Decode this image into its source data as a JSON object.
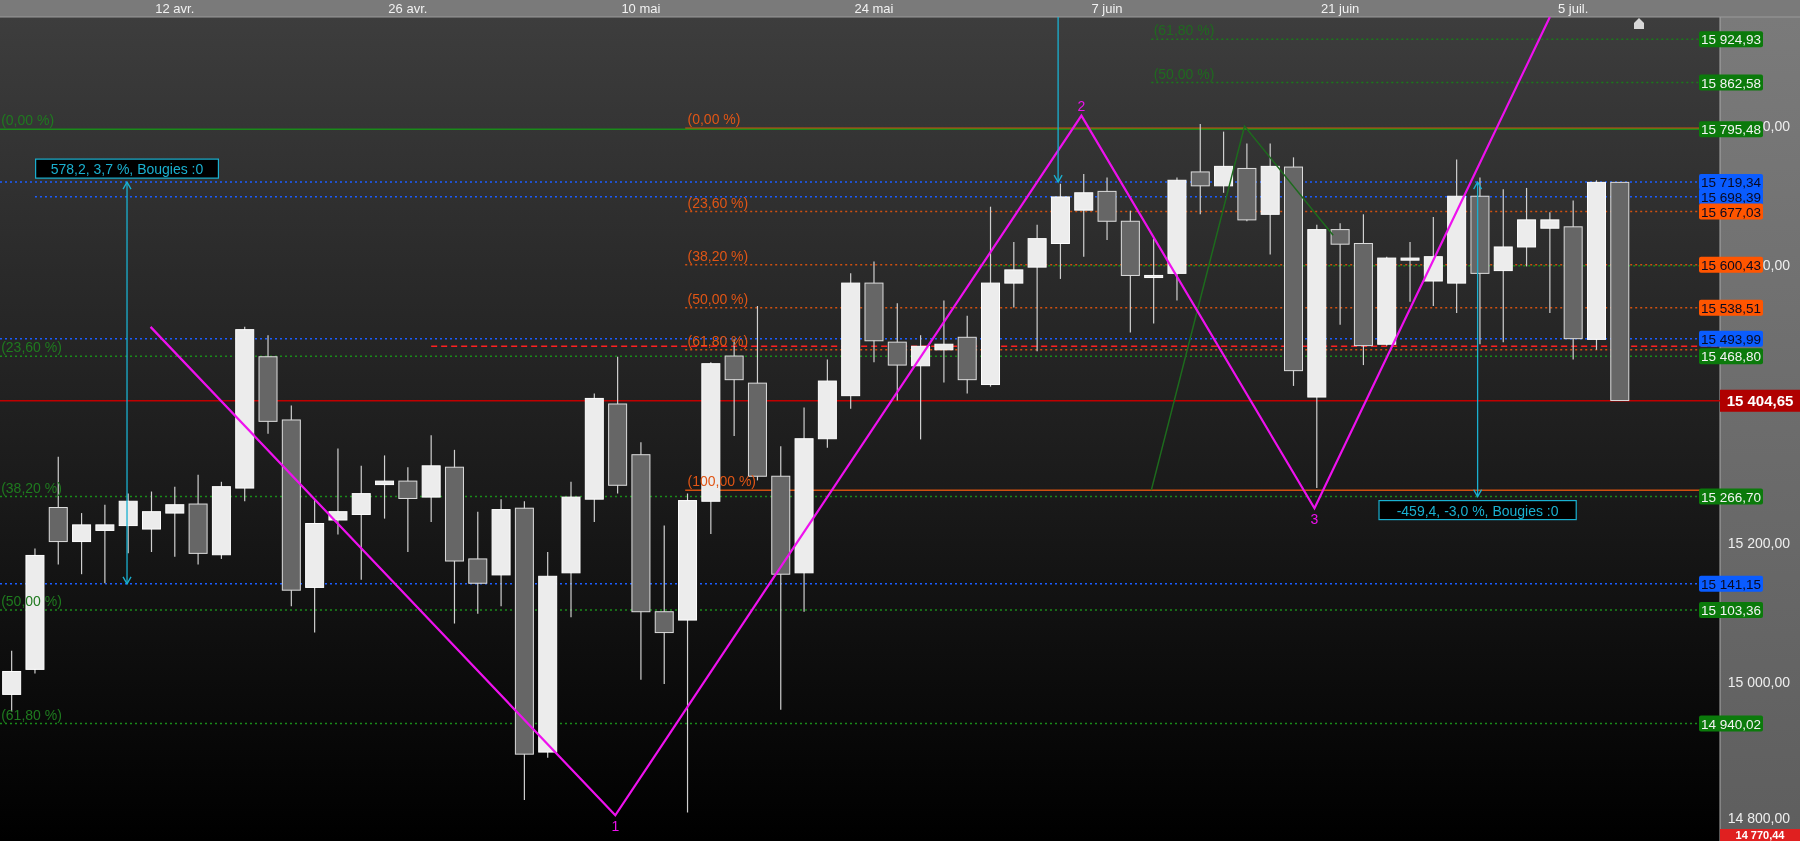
{
  "date_axis": [
    "12 avr.",
    "26 avr.",
    "10 mai",
    "24 mai",
    "7 juin",
    "21 juin",
    "5 juil."
  ],
  "price_axis": [
    "0,00",
    "0,00",
    "15 200,00",
    "15 000,00",
    "14 800,00"
  ],
  "fibonacci_labels": [
    "(0,00 %)",
    "(23,60 %)",
    "(38,20 %)",
    "(50,00 %)",
    "(61,80 %)",
    "(61,80 %)",
    "(50,00 %)",
    "(0,00 %)",
    "(23,60 %)",
    "(38,20 %)",
    "(50,00 %)",
    "(61,80 %)",
    "(100,00 %)"
  ],
  "wave_labels": [
    "1",
    "2",
    "3"
  ],
  "measure_labels": [
    "578,2, 3,7 %, Bougies :0",
    "-459,4, -3,0 %, Bougies :0"
  ],
  "price_tags": [
    {
      "text": "15 924,93",
      "color": "#0b7a0b"
    },
    {
      "text": "15 862,58",
      "color": "#0b7a0b"
    },
    {
      "text": "15 795,48",
      "color": "#0b7a0b"
    },
    {
      "text": "15 719,34",
      "color": "#0a5cff"
    },
    {
      "text": "15 698,39",
      "color": "#0a5cff"
    },
    {
      "text": "15 677,03",
      "color": "#ff5500"
    },
    {
      "text": "15 600,43",
      "color": "#ff5500"
    },
    {
      "text": "15 538,51",
      "color": "#ff5500"
    },
    {
      "text": "15 493,99",
      "color": "#0a5cff"
    },
    {
      "text": "15 468,80",
      "color": "#0b7a0b"
    },
    {
      "text": "15 266,70",
      "color": "#0b7a0b"
    },
    {
      "text": "15 141,15",
      "color": "#0a5cff"
    },
    {
      "text": "15 103,36",
      "color": "#0b7a0b"
    },
    {
      "text": "14 940,02",
      "color": "#0b7a0b"
    }
  ],
  "last_price_tags": [
    {
      "text": "15 404,65",
      "color": "#b00000"
    },
    {
      "text": "14 770,44",
      "color": "#e02020"
    }
  ]
}
